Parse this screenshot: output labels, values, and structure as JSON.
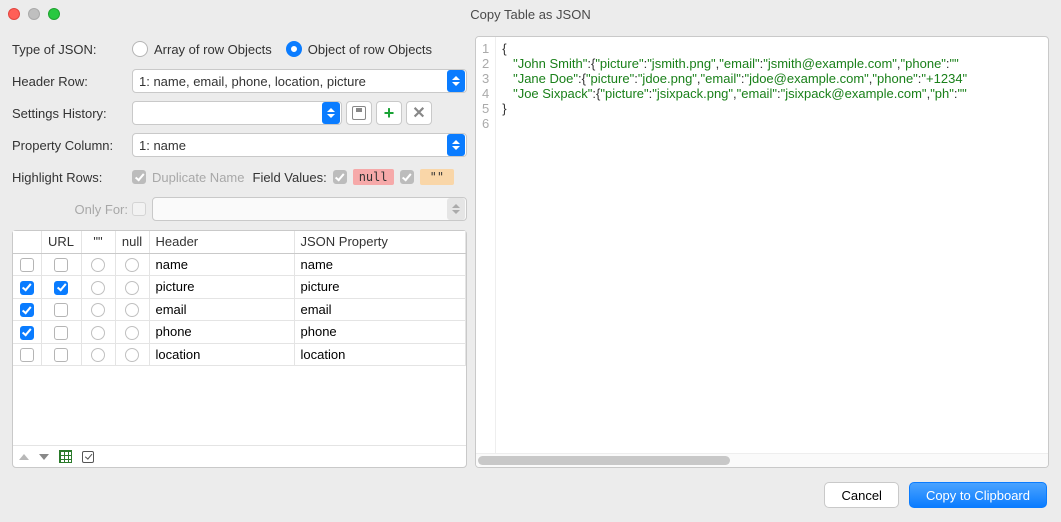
{
  "window": {
    "title": "Copy Table as JSON"
  },
  "labels": {
    "type_of_json": "Type of JSON:",
    "header_row": "Header Row:",
    "settings_history": "Settings History:",
    "property_column": "Property Column:",
    "highlight_rows": "Highlight Rows:",
    "field_values": "Field Values:",
    "only_for": "Only For:"
  },
  "json_type": {
    "array_label": "Array of row Objects",
    "object_label": "Object of row Objects",
    "selected": "object"
  },
  "header_row_value": "1: name, email, phone, location, picture",
  "settings_history_value": "",
  "property_column_value": "1: name",
  "highlight": {
    "duplicate_name_checked": true,
    "duplicate_name_label": "Duplicate Name",
    "null_checked": true,
    "null_label": "null",
    "empty_checked": true,
    "empty_label": "\"\""
  },
  "only_for_checked": false,
  "only_for_value": "",
  "table": {
    "columns": [
      "",
      "URL",
      "\"\"",
      "null",
      "Header",
      "JSON Property"
    ],
    "rows": [
      {
        "checked": false,
        "url": false,
        "header": "name",
        "property": "name"
      },
      {
        "checked": true,
        "url": true,
        "header": "picture",
        "property": "picture"
      },
      {
        "checked": true,
        "url": false,
        "header": "email",
        "property": "email"
      },
      {
        "checked": true,
        "url": false,
        "header": "phone",
        "property": "phone"
      },
      {
        "checked": false,
        "url": false,
        "header": "location",
        "property": "location"
      }
    ]
  },
  "code_lines": [
    {
      "n": 1,
      "raw": "{"
    },
    {
      "n": 2,
      "pairs": [
        [
          "John Smith",
          [
            [
              "picture",
              "jsmith.png"
            ],
            [
              "email",
              "jsmith@example.com"
            ],
            [
              "phone",
              ""
            ]
          ]
        ]
      ],
      "trail": ":"
    },
    {
      "n": 3,
      "pairs": [
        [
          "Jane Doe",
          [
            [
              "picture",
              "jdoe.png"
            ],
            [
              "email",
              "jdoe@example.com"
            ],
            [
              "phone",
              "+1234"
            ]
          ]
        ]
      ],
      "trail": ""
    },
    {
      "n": 4,
      "pairs": [
        [
          "Joe Sixpack",
          [
            [
              "picture",
              "jsixpack.png"
            ],
            [
              "email",
              "jsixpack@example.com"
            ],
            [
              "ph",
              ""
            ]
          ]
        ]
      ],
      "trail": ""
    },
    {
      "n": 5,
      "raw": "}"
    },
    {
      "n": 6,
      "raw": ""
    }
  ],
  "buttons": {
    "cancel": "Cancel",
    "copy": "Copy to Clipboard"
  }
}
